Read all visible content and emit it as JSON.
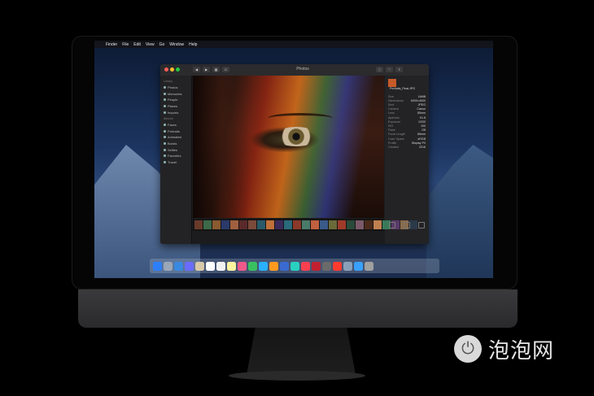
{
  "menubar": {
    "apple": "",
    "items": [
      "Finder",
      "File",
      "Edit",
      "View",
      "Go",
      "Window",
      "Help"
    ]
  },
  "window": {
    "title": "Photos",
    "toolbar_left": [
      "◀",
      "▶",
      "▦",
      "☐"
    ],
    "toolbar_right": [
      "ⓘ",
      "♡",
      "⇪"
    ]
  },
  "sidebar": {
    "sections": [
      {
        "header": "Library",
        "items": [
          "Photos",
          "Memories",
          "People",
          "Places",
          "Imports"
        ]
      },
      {
        "header": "Albums",
        "items": [
          "Faces",
          "Portraits",
          "Animated",
          "Bursts",
          "Selfies",
          "Favorites",
          "Travel"
        ]
      }
    ]
  },
  "info_panel": {
    "title": "Portraits_Final.JPG",
    "rows": [
      {
        "k": "Size",
        "v": "16MB"
      },
      {
        "k": "Dimensions",
        "v": "6000×4000"
      },
      {
        "k": "Kind",
        "v": "JPEG"
      },
      {
        "k": "Camera",
        "v": "Canon"
      },
      {
        "k": "Lens",
        "v": "85mm"
      },
      {
        "k": "Aperture",
        "v": "f/1.8"
      },
      {
        "k": "Exposure",
        "v": "1/200"
      },
      {
        "k": "ISO",
        "v": "100"
      },
      {
        "k": "Flash",
        "v": "Off"
      },
      {
        "k": "Focal Length",
        "v": "85mm"
      },
      {
        "k": "Color Space",
        "v": "sRGB"
      },
      {
        "k": "Profile",
        "v": "Display P3"
      },
      {
        "k": "Created",
        "v": "2018"
      }
    ]
  },
  "filmstrip": {
    "thumb_colors": [
      "#6a3a2a",
      "#3d6a4a",
      "#8a5a30",
      "#2a3a6a",
      "#a06040",
      "#5a2a2a",
      "#7a4a3a",
      "#2a5a6a",
      "#c0703a",
      "#3a2a5a",
      "#2a6a7a",
      "#8a3a2a",
      "#4a7a6a",
      "#c06040",
      "#3a5a8a",
      "#6a6a3a",
      "#a03a2a",
      "#2a4a3a",
      "#7a5a6a",
      "#4a2a1a",
      "#c08050",
      "#3a7a5a",
      "#5a3a6a",
      "#8a6a4a",
      "#2a3a4a"
    ]
  },
  "dock": {
    "icon_colors": [
      "#2d7ff9",
      "#9aa7b8",
      "#3a89e0",
      "#6b6bff",
      "#d8c9a8",
      "#ffffff",
      "#f2f2f2",
      "#fff3a0",
      "#f05a8a",
      "#3ac060",
      "#2ab0ff",
      "#ff9a20",
      "#3a6ad0",
      "#2ad0c0",
      "#fa4050",
      "#c02030",
      "#6a6a6a",
      "#ff3b30",
      "#8aa0b8",
      "#3aa0ff",
      "#a0a0a0"
    ]
  },
  "watermark": {
    "text": "泡泡网"
  }
}
